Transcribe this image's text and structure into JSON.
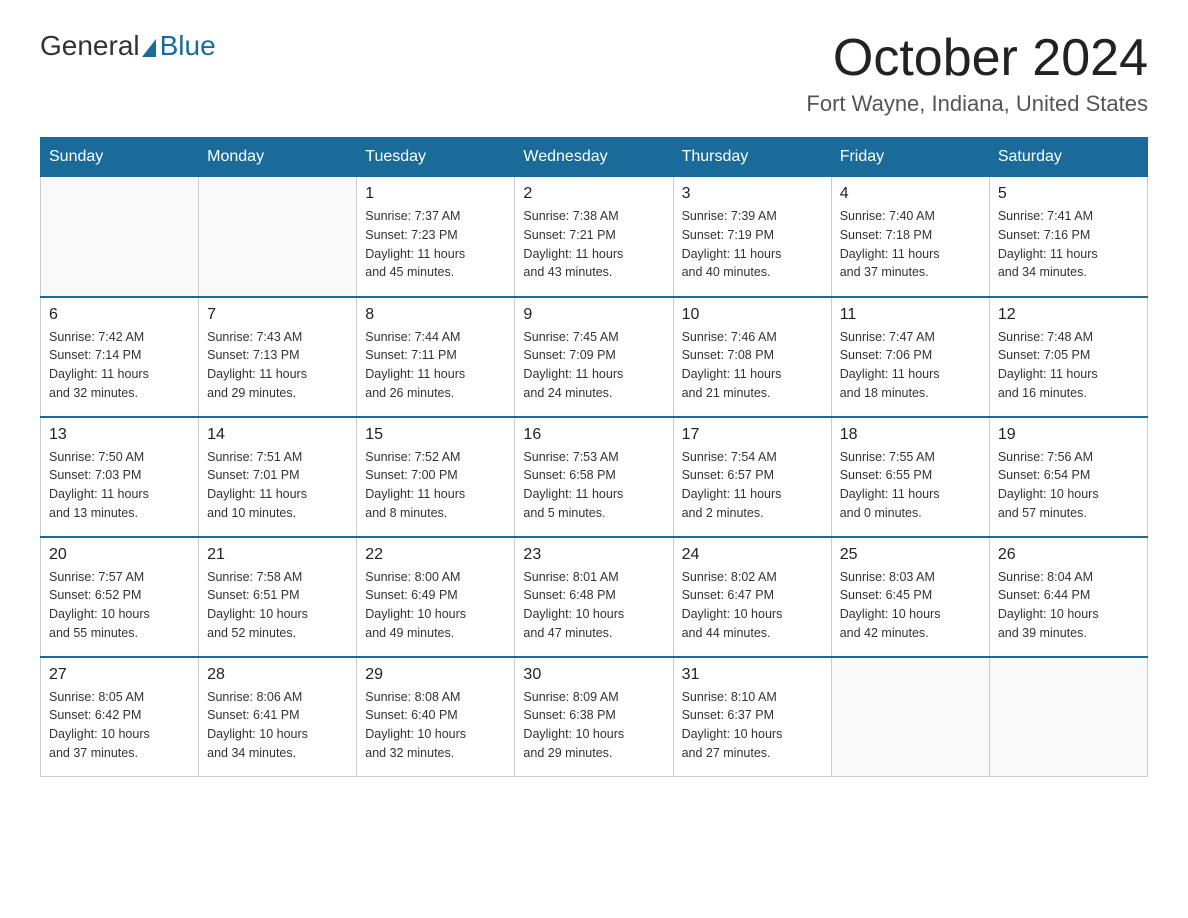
{
  "header": {
    "logo_general": "General",
    "logo_blue": "Blue",
    "month_title": "October 2024",
    "location": "Fort Wayne, Indiana, United States"
  },
  "days_of_week": [
    "Sunday",
    "Monday",
    "Tuesday",
    "Wednesday",
    "Thursday",
    "Friday",
    "Saturday"
  ],
  "weeks": [
    [
      {
        "day": "",
        "info": ""
      },
      {
        "day": "",
        "info": ""
      },
      {
        "day": "1",
        "info": "Sunrise: 7:37 AM\nSunset: 7:23 PM\nDaylight: 11 hours\nand 45 minutes."
      },
      {
        "day": "2",
        "info": "Sunrise: 7:38 AM\nSunset: 7:21 PM\nDaylight: 11 hours\nand 43 minutes."
      },
      {
        "day": "3",
        "info": "Sunrise: 7:39 AM\nSunset: 7:19 PM\nDaylight: 11 hours\nand 40 minutes."
      },
      {
        "day": "4",
        "info": "Sunrise: 7:40 AM\nSunset: 7:18 PM\nDaylight: 11 hours\nand 37 minutes."
      },
      {
        "day": "5",
        "info": "Sunrise: 7:41 AM\nSunset: 7:16 PM\nDaylight: 11 hours\nand 34 minutes."
      }
    ],
    [
      {
        "day": "6",
        "info": "Sunrise: 7:42 AM\nSunset: 7:14 PM\nDaylight: 11 hours\nand 32 minutes."
      },
      {
        "day": "7",
        "info": "Sunrise: 7:43 AM\nSunset: 7:13 PM\nDaylight: 11 hours\nand 29 minutes."
      },
      {
        "day": "8",
        "info": "Sunrise: 7:44 AM\nSunset: 7:11 PM\nDaylight: 11 hours\nand 26 minutes."
      },
      {
        "day": "9",
        "info": "Sunrise: 7:45 AM\nSunset: 7:09 PM\nDaylight: 11 hours\nand 24 minutes."
      },
      {
        "day": "10",
        "info": "Sunrise: 7:46 AM\nSunset: 7:08 PM\nDaylight: 11 hours\nand 21 minutes."
      },
      {
        "day": "11",
        "info": "Sunrise: 7:47 AM\nSunset: 7:06 PM\nDaylight: 11 hours\nand 18 minutes."
      },
      {
        "day": "12",
        "info": "Sunrise: 7:48 AM\nSunset: 7:05 PM\nDaylight: 11 hours\nand 16 minutes."
      }
    ],
    [
      {
        "day": "13",
        "info": "Sunrise: 7:50 AM\nSunset: 7:03 PM\nDaylight: 11 hours\nand 13 minutes."
      },
      {
        "day": "14",
        "info": "Sunrise: 7:51 AM\nSunset: 7:01 PM\nDaylight: 11 hours\nand 10 minutes."
      },
      {
        "day": "15",
        "info": "Sunrise: 7:52 AM\nSunset: 7:00 PM\nDaylight: 11 hours\nand 8 minutes."
      },
      {
        "day": "16",
        "info": "Sunrise: 7:53 AM\nSunset: 6:58 PM\nDaylight: 11 hours\nand 5 minutes."
      },
      {
        "day": "17",
        "info": "Sunrise: 7:54 AM\nSunset: 6:57 PM\nDaylight: 11 hours\nand 2 minutes."
      },
      {
        "day": "18",
        "info": "Sunrise: 7:55 AM\nSunset: 6:55 PM\nDaylight: 11 hours\nand 0 minutes."
      },
      {
        "day": "19",
        "info": "Sunrise: 7:56 AM\nSunset: 6:54 PM\nDaylight: 10 hours\nand 57 minutes."
      }
    ],
    [
      {
        "day": "20",
        "info": "Sunrise: 7:57 AM\nSunset: 6:52 PM\nDaylight: 10 hours\nand 55 minutes."
      },
      {
        "day": "21",
        "info": "Sunrise: 7:58 AM\nSunset: 6:51 PM\nDaylight: 10 hours\nand 52 minutes."
      },
      {
        "day": "22",
        "info": "Sunrise: 8:00 AM\nSunset: 6:49 PM\nDaylight: 10 hours\nand 49 minutes."
      },
      {
        "day": "23",
        "info": "Sunrise: 8:01 AM\nSunset: 6:48 PM\nDaylight: 10 hours\nand 47 minutes."
      },
      {
        "day": "24",
        "info": "Sunrise: 8:02 AM\nSunset: 6:47 PM\nDaylight: 10 hours\nand 44 minutes."
      },
      {
        "day": "25",
        "info": "Sunrise: 8:03 AM\nSunset: 6:45 PM\nDaylight: 10 hours\nand 42 minutes."
      },
      {
        "day": "26",
        "info": "Sunrise: 8:04 AM\nSunset: 6:44 PM\nDaylight: 10 hours\nand 39 minutes."
      }
    ],
    [
      {
        "day": "27",
        "info": "Sunrise: 8:05 AM\nSunset: 6:42 PM\nDaylight: 10 hours\nand 37 minutes."
      },
      {
        "day": "28",
        "info": "Sunrise: 8:06 AM\nSunset: 6:41 PM\nDaylight: 10 hours\nand 34 minutes."
      },
      {
        "day": "29",
        "info": "Sunrise: 8:08 AM\nSunset: 6:40 PM\nDaylight: 10 hours\nand 32 minutes."
      },
      {
        "day": "30",
        "info": "Sunrise: 8:09 AM\nSunset: 6:38 PM\nDaylight: 10 hours\nand 29 minutes."
      },
      {
        "day": "31",
        "info": "Sunrise: 8:10 AM\nSunset: 6:37 PM\nDaylight: 10 hours\nand 27 minutes."
      },
      {
        "day": "",
        "info": ""
      },
      {
        "day": "",
        "info": ""
      }
    ]
  ]
}
